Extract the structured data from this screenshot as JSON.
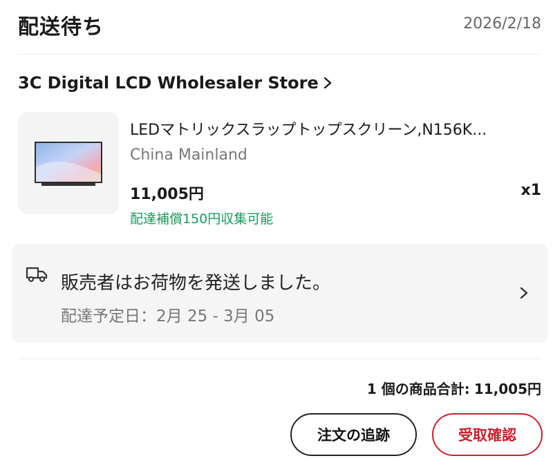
{
  "header": {
    "status_title": "配送待ち",
    "order_date": "2026/2/18"
  },
  "store": {
    "name": "3C Digital LCD Wholesaler Store"
  },
  "product": {
    "title": "LEDマトリックスラップトップスクリーン,N156K...",
    "origin": "China Mainland",
    "price": "11,005円",
    "quantity": "x1",
    "shipping_note": "配達補償150円収集可能"
  },
  "shipment": {
    "status": "販売者はお荷物を発送しました。",
    "eta": "配達予定日：2月 25 - 3月 05"
  },
  "total": {
    "label": "1 個の商品合計:",
    "amount": "11,005円"
  },
  "actions": {
    "track_label": "注文の追跡",
    "confirm_label": "受取確認"
  },
  "colors": {
    "accent_red": "#c8212f",
    "success_green": "#1a9a5e"
  },
  "icons": {
    "store_chevron": "chevron-right-icon",
    "truck": "truck-icon",
    "card_chevron": "chevron-right-icon"
  }
}
